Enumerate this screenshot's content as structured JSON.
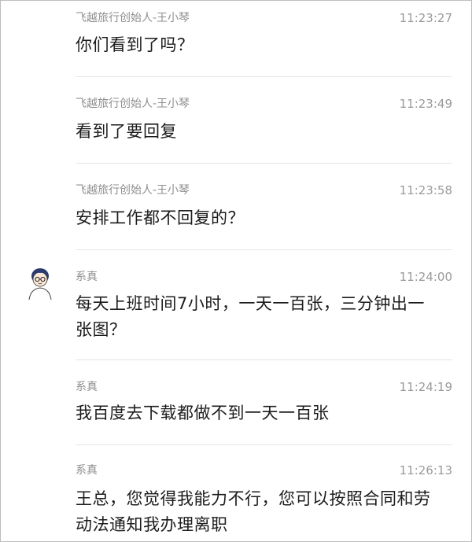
{
  "messages": [
    {
      "sender": "飞越旅行创始人-王小琴",
      "time": "11:23:27",
      "text": "你们看到了吗？"
    },
    {
      "sender": "飞越旅行创始人-王小琴",
      "time": "11:23:49",
      "text": "看到了要回复"
    },
    {
      "sender": "飞越旅行创始人-王小琴",
      "time": "11:23:58",
      "text": "安排工作都不回复的？"
    },
    {
      "sender": "系真",
      "time": "11:24:00",
      "text": "每天上班时间7小时，一天一百张，三分钟出一张图？"
    },
    {
      "sender": "系真",
      "time": "11:24:19",
      "text": "我百度去下载都做不到一天一百张"
    },
    {
      "sender": "系真",
      "time": "11:26:13",
      "text": "王总，您觉得我能力不行，您可以按照合同和劳动法通知我办理离职"
    }
  ],
  "avatar_icon": "cartoon-person-avatar"
}
